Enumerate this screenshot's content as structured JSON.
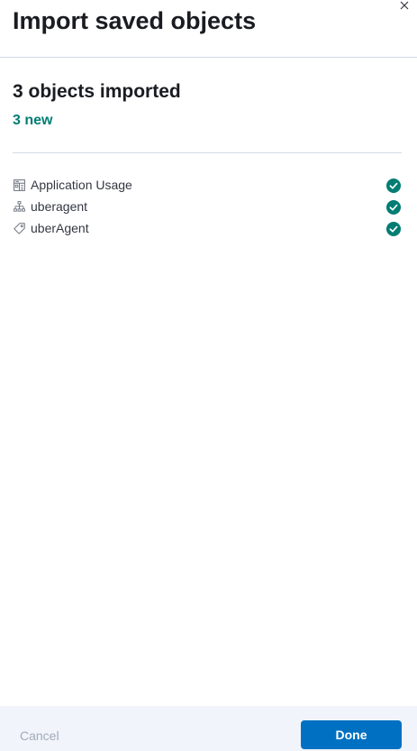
{
  "header": {
    "title": "Import saved objects",
    "close_icon": "close-icon"
  },
  "summary": {
    "title": "3 objects imported",
    "new_count": "3 new",
    "accent_color": "#017d73"
  },
  "objects": [
    {
      "icon": "dashboard-icon",
      "label": "Application Usage",
      "status": "success-check-icon"
    },
    {
      "icon": "index-pattern-icon",
      "label": "uberagent",
      "status": "success-check-icon"
    },
    {
      "icon": "tag-icon",
      "label": "uberAgent",
      "status": "success-check-icon"
    }
  ],
  "footer": {
    "cancel_label": "Cancel",
    "done_label": "Done",
    "primary_color": "#0071c2"
  }
}
